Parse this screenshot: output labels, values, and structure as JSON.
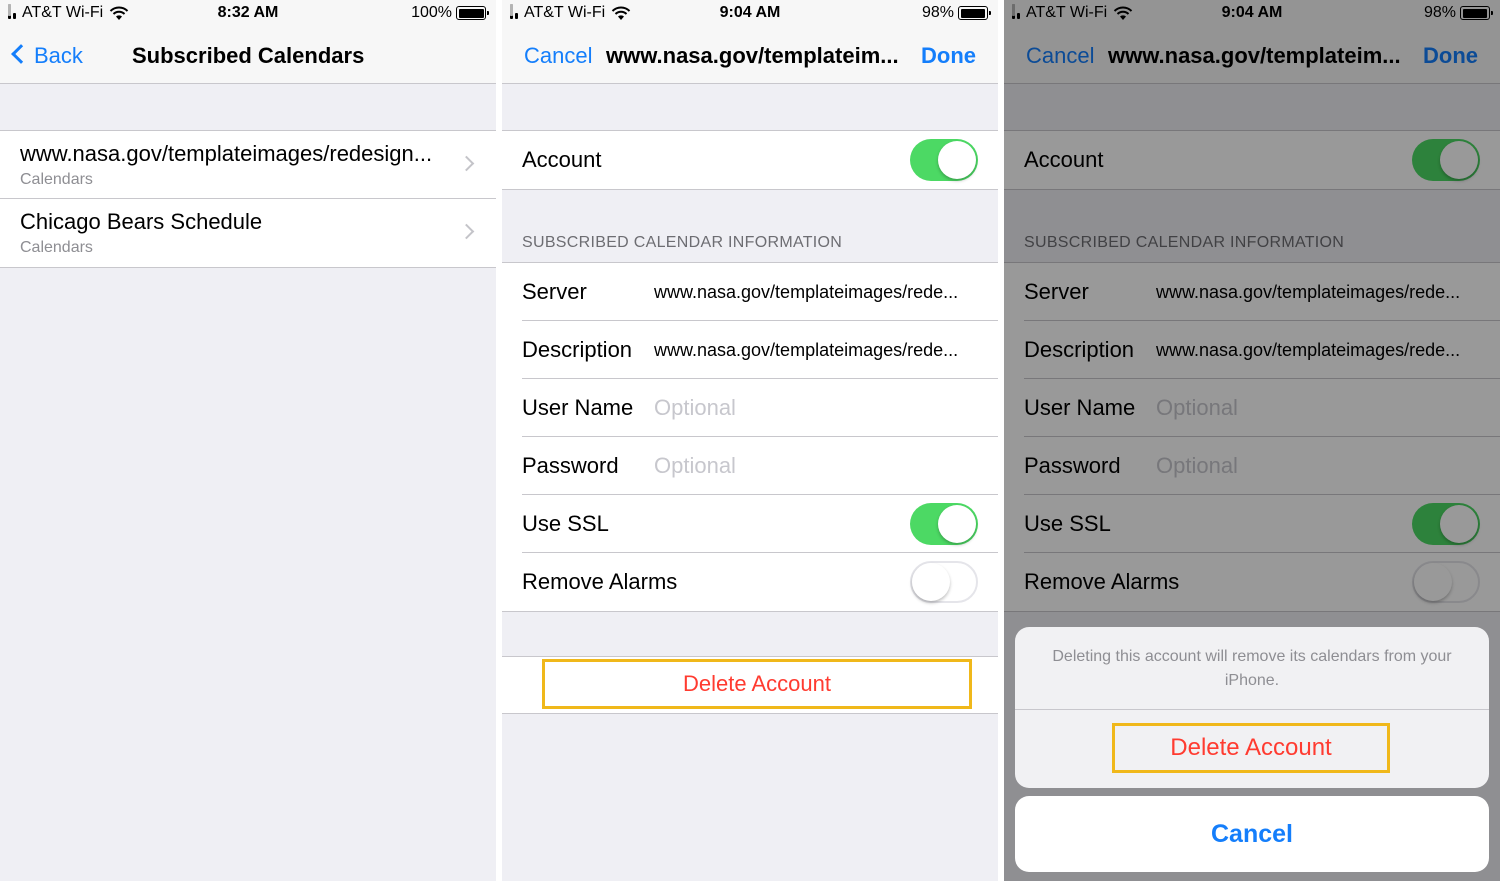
{
  "panel1": {
    "status": {
      "carrier": "AT&T Wi-Fi",
      "time": "8:32 AM",
      "battery": "100%",
      "battery_level": 1.0
    },
    "nav": {
      "back_label": "Back",
      "title": "Subscribed Calendars"
    },
    "calendars": [
      {
        "title": "www.nasa.gov/templateimages/redesign...",
        "subtitle": "Calendars"
      },
      {
        "title": "Chicago Bears Schedule",
        "subtitle": "Calendars"
      }
    ]
  },
  "panel2": {
    "status": {
      "carrier": "AT&T Wi-Fi",
      "time": "9:04 AM",
      "battery": "98%",
      "battery_level": 0.98
    },
    "nav": {
      "cancel_label": "Cancel",
      "title": "www.nasa.gov/templateim...",
      "done_label": "Done"
    },
    "account": {
      "label": "Account",
      "on": true
    },
    "section_header": "SUBSCRIBED CALENDAR INFORMATION",
    "fields": {
      "server": {
        "label": "Server",
        "value": "www.nasa.gov/templateimages/rede..."
      },
      "description": {
        "label": "Description",
        "value": "www.nasa.gov/templateimages/rede..."
      },
      "username": {
        "label": "User Name",
        "placeholder": "Optional"
      },
      "password": {
        "label": "Password",
        "placeholder": "Optional"
      },
      "use_ssl": {
        "label": "Use SSL",
        "on": true
      },
      "remove_alarms": {
        "label": "Remove Alarms",
        "on": false
      }
    },
    "delete_label": "Delete Account"
  },
  "panel3": {
    "status": {
      "carrier": "AT&T Wi-Fi",
      "time": "9:04 AM",
      "battery": "98%",
      "battery_level": 0.98
    },
    "nav": {
      "cancel_label": "Cancel",
      "title": "www.nasa.gov/templateim...",
      "done_label": "Done"
    },
    "account": {
      "label": "Account",
      "on": true
    },
    "section_header": "SUBSCRIBED CALENDAR INFORMATION",
    "fields": {
      "server": {
        "label": "Server",
        "value": "www.nasa.gov/templateimages/rede..."
      },
      "description": {
        "label": "Description",
        "value": "www.nasa.gov/templateimages/rede..."
      },
      "username": {
        "label": "User Name",
        "placeholder": "Optional"
      },
      "password": {
        "label": "Password",
        "placeholder": "Optional"
      },
      "use_ssl": {
        "label": "Use SSL",
        "on": true
      },
      "remove_alarms": {
        "label": "Remove Alarms",
        "on": false
      }
    },
    "action_sheet": {
      "message": "Deleting this account will remove its calendars from your iPhone.",
      "delete_label": "Delete Account",
      "cancel_label": "Cancel"
    }
  },
  "colors": {
    "ios_blue": "#147efb",
    "toggle_green": "#4cd964",
    "destructive_red": "#ff3b30",
    "highlight_yellow": "#f0b81a"
  },
  "icons": [
    "signal-bars-icon",
    "wifi-icon",
    "battery-icon",
    "chevron-left-icon",
    "chevron-right-icon"
  ]
}
